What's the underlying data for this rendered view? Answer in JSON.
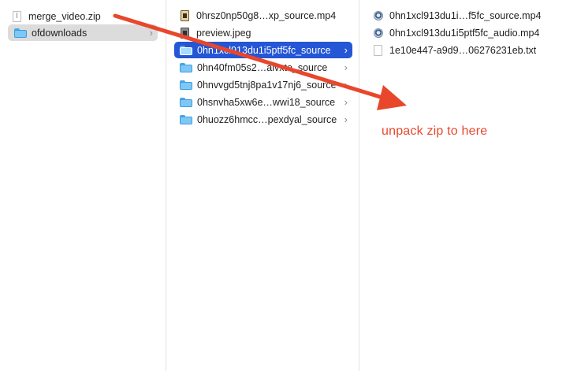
{
  "columns": {
    "col1": {
      "items": [
        {
          "label": "merge_video.zip",
          "icon": "zip-file-icon"
        },
        {
          "label": "ofdownloads",
          "icon": "folder-icon"
        }
      ]
    },
    "col2": {
      "items": [
        {
          "label": "0hrsz0np50g8…xp_source.mp4",
          "icon": "video-file-icon"
        },
        {
          "label": "preview.jpeg",
          "icon": "image-file-icon"
        },
        {
          "label": "0hn1xcl913du1i5ptf5fc_source",
          "icon": "folder-icon"
        },
        {
          "label": "0hn40fm05s2…alvxte_source",
          "icon": "folder-icon"
        },
        {
          "label": "0hnvvgd5tnj8pa1v17nj6_source",
          "icon": "folder-icon"
        },
        {
          "label": "0hsnvha5xw6e…wwi18_source",
          "icon": "folder-icon"
        },
        {
          "label": "0huozz6hmcc…pexdyal_source",
          "icon": "folder-icon"
        }
      ]
    },
    "col3": {
      "items": [
        {
          "label": "0hn1xcl913du1i…f5fc_source.mp4",
          "icon": "quicktime-icon"
        },
        {
          "label": "0hn1xcl913du1i5ptf5fc_audio.mp4",
          "icon": "quicktime-icon"
        },
        {
          "label": "1e10e447-a9d9…06276231eb.txt",
          "icon": "text-file-icon"
        }
      ]
    }
  },
  "chevron": "›",
  "annotation": {
    "text": "unpack zip to here"
  },
  "colors": {
    "selection": "#2456d6",
    "arrow": "#e8472c"
  }
}
